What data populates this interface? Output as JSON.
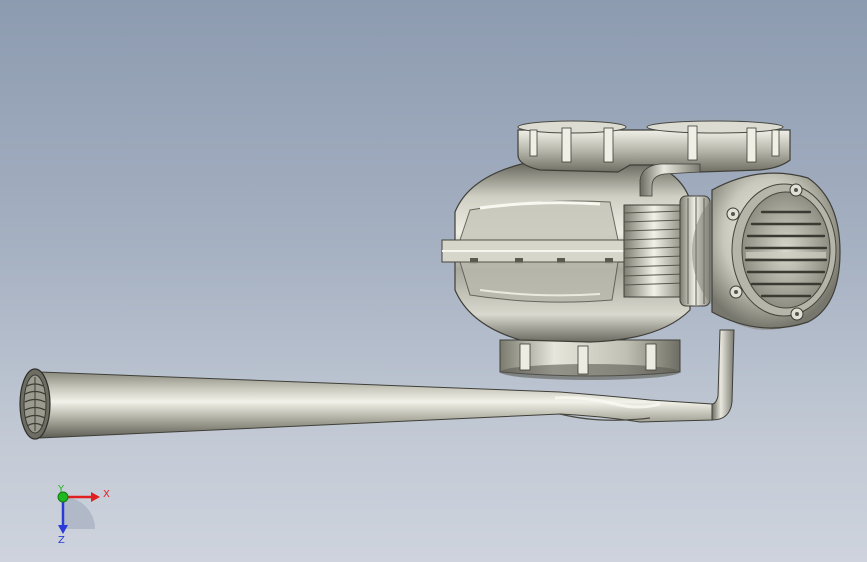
{
  "viewport": {
    "model": "cad-part-assembly"
  },
  "triad": {
    "x_label": "X",
    "y_label": "Y",
    "z_label": "Z",
    "colors": {
      "x": "#e02020",
      "y": "#1fb81f",
      "z": "#2a3ad8"
    }
  }
}
